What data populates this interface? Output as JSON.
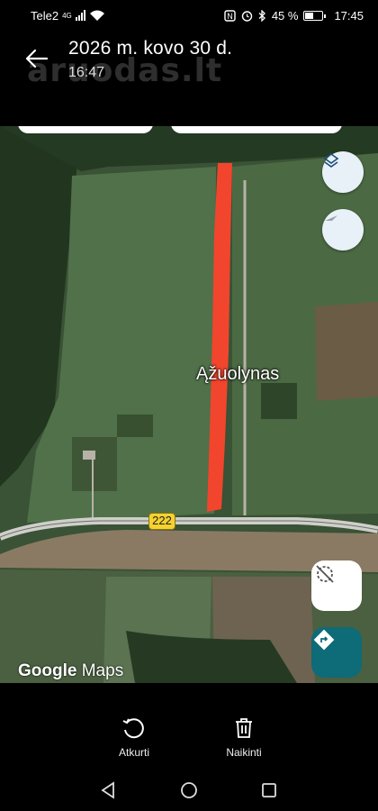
{
  "status_bar": {
    "carrier": "Tele2",
    "network": "4G",
    "battery_text": "45 %",
    "battery_level": 0.45,
    "time": "17:45",
    "icons": [
      "signal-icon",
      "wifi-icon",
      "nfc-icon",
      "alarm-icon",
      "bluetooth-icon",
      "battery-icon"
    ]
  },
  "header": {
    "title": "2026 m. kovo 30 d.",
    "subtitle": "16:47",
    "watermark": "aruodas.lt",
    "back_icon": "arrow-left-icon"
  },
  "map": {
    "place_label": "Ąžuolynas",
    "road_number": "222",
    "attribution_google": "Google",
    "attribution_maps": "Maps",
    "buttons": [
      "layers-icon",
      "compass-icon",
      "location-off-icon",
      "directions-icon"
    ],
    "colors": {
      "highlight": "#f2452d",
      "field": "#4d6b45",
      "forest": "#2a3e26",
      "road": "#c9c9c4",
      "directions_bg": "#0e6b78"
    }
  },
  "actions": {
    "undo_label": "Atkurti",
    "delete_label": "Naikinti"
  },
  "nav": [
    "back-triangle-icon",
    "home-circle-icon",
    "recents-square-icon"
  ]
}
